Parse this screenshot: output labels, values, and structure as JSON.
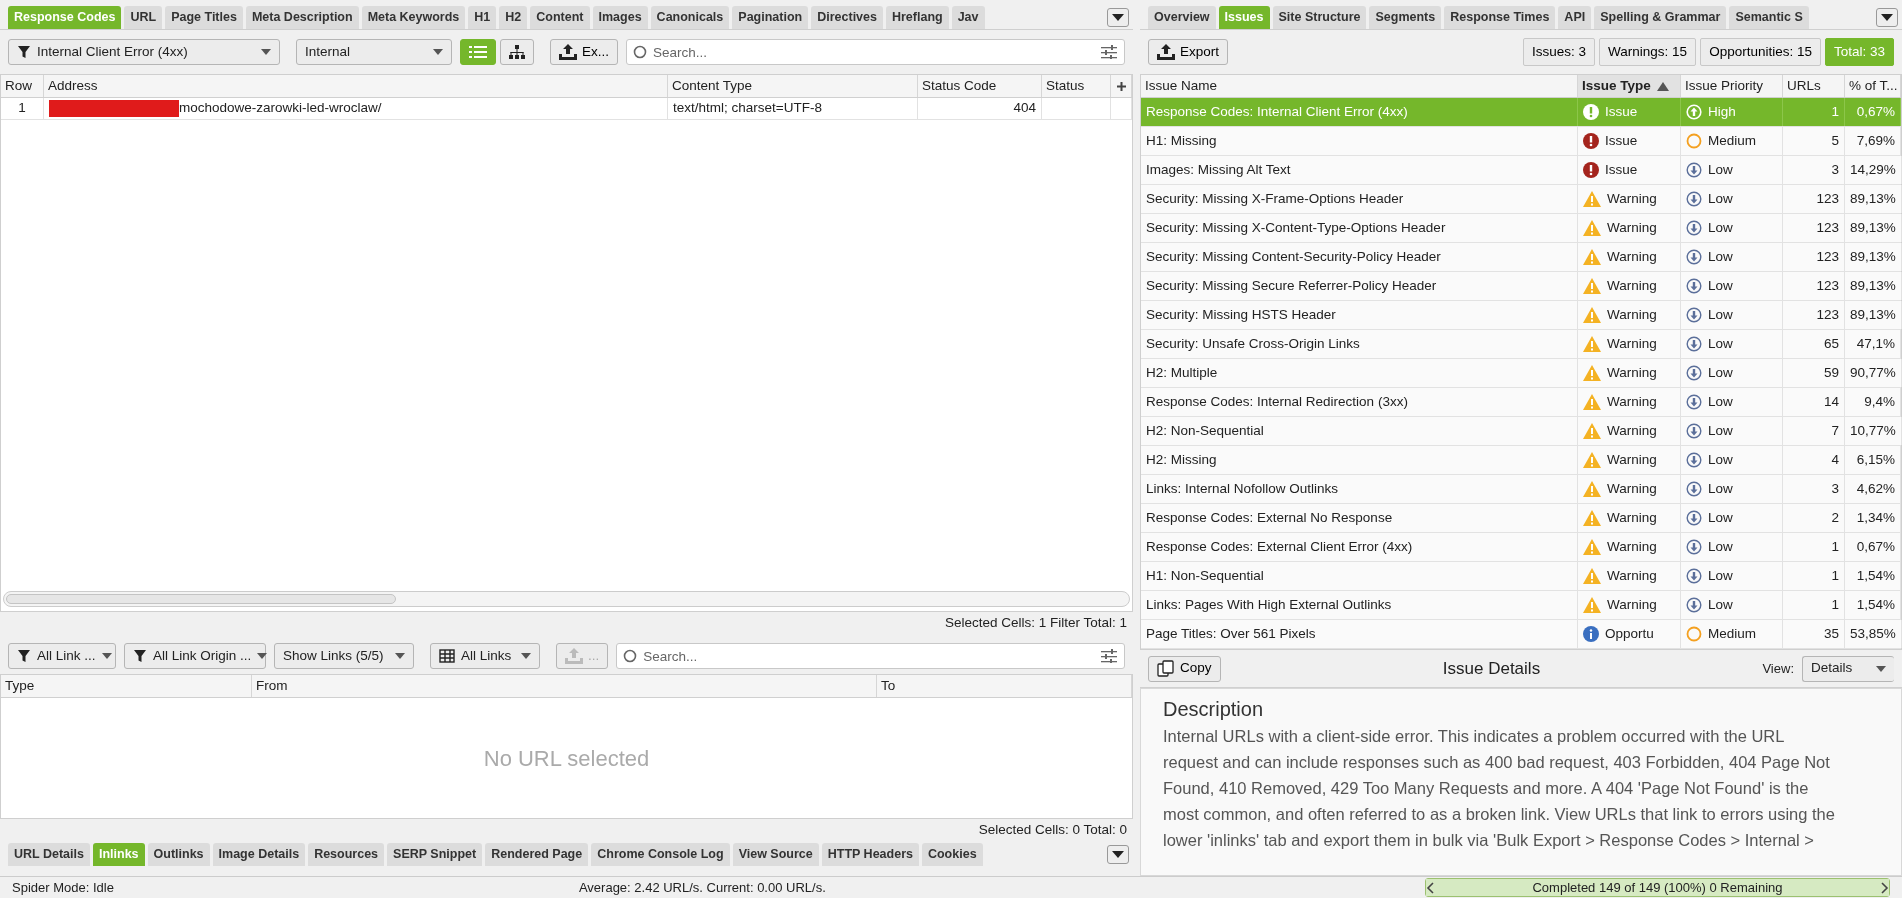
{
  "left_tabs": [
    {
      "label": "Response Codes",
      "selected": true
    },
    {
      "label": "URL",
      "selected": false
    },
    {
      "label": "Page Titles",
      "selected": false
    },
    {
      "label": "Meta Description",
      "selected": false
    },
    {
      "label": "Meta Keywords",
      "selected": false
    },
    {
      "label": "H1",
      "selected": false
    },
    {
      "label": "H2",
      "selected": false
    },
    {
      "label": "Content",
      "selected": false
    },
    {
      "label": "Images",
      "selected": false
    },
    {
      "label": "Canonicals",
      "selected": false
    },
    {
      "label": "Pagination",
      "selected": false
    },
    {
      "label": "Directives",
      "selected": false
    },
    {
      "label": "Hreflang",
      "selected": false
    },
    {
      "label": "Jav",
      "selected": false
    }
  ],
  "main_toolbar": {
    "status_filter": "Internal Client Error (4xx)",
    "scope": "Internal",
    "view_modes": [
      {
        "kind": "list",
        "selected": true
      },
      {
        "kind": "tree",
        "selected": false
      }
    ],
    "export_label": "Ex...",
    "search_placeholder": "Search..."
  },
  "main_table": {
    "columns": [
      "Row",
      "Address",
      "Content Type",
      "Status Code",
      "Status"
    ],
    "rows": [
      {
        "row": "1",
        "address": "mochodowe-zarowki-led-wroclaw/",
        "redacted": true,
        "content_type": "text/html; charset=UTF-8",
        "status_code": "404"
      }
    ],
    "footer": "Selected Cells:  1  Filter Total:  1"
  },
  "links_toolbar": {
    "dropdowns": [
      {
        "kind": "filter",
        "label": "All Link ..."
      },
      {
        "kind": "filter",
        "label": "All Link Origin ..."
      },
      {
        "kind": "plain",
        "label": "Show Links (5/5)"
      },
      {
        "kind": "table",
        "label": "All Links"
      }
    ],
    "export_label": "...",
    "export_disabled": true,
    "search_placeholder": "Search..."
  },
  "links_table": {
    "columns": [
      "Type",
      "From",
      "To"
    ],
    "empty_message": "No URL selected",
    "footer": "Selected Cells:  0  Total:  0"
  },
  "bottom_tabs": [
    {
      "label": "URL Details",
      "selected": false
    },
    {
      "label": "Inlinks",
      "selected": true
    },
    {
      "label": "Outlinks",
      "selected": false
    },
    {
      "label": "Image Details",
      "selected": false
    },
    {
      "label": "Resources",
      "selected": false
    },
    {
      "label": "SERP Snippet",
      "selected": false
    },
    {
      "label": "Rendered Page",
      "selected": false
    },
    {
      "label": "Chrome Console Log",
      "selected": false
    },
    {
      "label": "View Source",
      "selected": false
    },
    {
      "label": "HTTP Headers",
      "selected": false
    },
    {
      "label": "Cookies",
      "selected": false
    }
  ],
  "right_tabs": [
    {
      "label": "Overview",
      "selected": false
    },
    {
      "label": "Issues",
      "selected": true
    },
    {
      "label": "Site Structure",
      "selected": false
    },
    {
      "label": "Segments",
      "selected": false
    },
    {
      "label": "Response Times",
      "selected": false
    },
    {
      "label": "API",
      "selected": false
    },
    {
      "label": "Spelling & Grammar",
      "selected": false
    },
    {
      "label": "Semantic S",
      "selected": false
    }
  ],
  "issues_toolbar": {
    "export_label": "Export",
    "counts": [
      {
        "label": "Issues: 3",
        "selected": false
      },
      {
        "label": "Warnings: 15",
        "selected": false
      },
      {
        "label": "Opportunities: 15",
        "selected": false
      },
      {
        "label": "Total: 33",
        "selected": true
      }
    ]
  },
  "issues_table": {
    "columns": [
      {
        "label": "Issue Name",
        "sorted": false
      },
      {
        "label": "Issue Type",
        "sorted": true
      },
      {
        "label": "Issue Priority",
        "sorted": false
      },
      {
        "label": "URLs",
        "sorted": false
      },
      {
        "label": "% of T...",
        "sorted": false
      }
    ],
    "rows": [
      {
        "name": "Response Codes: Internal Client Error (4xx)",
        "type": {
          "kind": "issue",
          "label": "Issue"
        },
        "priority": {
          "kind": "high",
          "label": "High"
        },
        "urls": "1",
        "percent": "0,67%",
        "selected": true
      },
      {
        "name": "H1: Missing",
        "type": {
          "kind": "issue",
          "label": "Issue"
        },
        "priority": {
          "kind": "medium",
          "label": "Medium"
        },
        "urls": "5",
        "percent": "7,69%",
        "selected": false
      },
      {
        "name": "Images: Missing Alt Text",
        "type": {
          "kind": "issue",
          "label": "Issue"
        },
        "priority": {
          "kind": "low",
          "label": "Low"
        },
        "urls": "3",
        "percent": "14,29%",
        "selected": false
      },
      {
        "name": "Security: Missing X-Frame-Options Header",
        "type": {
          "kind": "warning",
          "label": "Warning"
        },
        "priority": {
          "kind": "low",
          "label": "Low"
        },
        "urls": "123",
        "percent": "89,13%",
        "selected": false
      },
      {
        "name": "Security: Missing X-Content-Type-Options Header",
        "type": {
          "kind": "warning",
          "label": "Warning"
        },
        "priority": {
          "kind": "low",
          "label": "Low"
        },
        "urls": "123",
        "percent": "89,13%",
        "selected": false
      },
      {
        "name": "Security: Missing Content-Security-Policy Header",
        "type": {
          "kind": "warning",
          "label": "Warning"
        },
        "priority": {
          "kind": "low",
          "label": "Low"
        },
        "urls": "123",
        "percent": "89,13%",
        "selected": false
      },
      {
        "name": "Security: Missing Secure Referrer-Policy Header",
        "type": {
          "kind": "warning",
          "label": "Warning"
        },
        "priority": {
          "kind": "low",
          "label": "Low"
        },
        "urls": "123",
        "percent": "89,13%",
        "selected": false
      },
      {
        "name": "Security: Missing HSTS Header",
        "type": {
          "kind": "warning",
          "label": "Warning"
        },
        "priority": {
          "kind": "low",
          "label": "Low"
        },
        "urls": "123",
        "percent": "89,13%",
        "selected": false
      },
      {
        "name": "Security: Unsafe Cross-Origin Links",
        "type": {
          "kind": "warning",
          "label": "Warning"
        },
        "priority": {
          "kind": "low",
          "label": "Low"
        },
        "urls": "65",
        "percent": "47,1%",
        "selected": false
      },
      {
        "name": "H2: Multiple",
        "type": {
          "kind": "warning",
          "label": "Warning"
        },
        "priority": {
          "kind": "low",
          "label": "Low"
        },
        "urls": "59",
        "percent": "90,77%",
        "selected": false
      },
      {
        "name": "Response Codes: Internal Redirection (3xx)",
        "type": {
          "kind": "warning",
          "label": "Warning"
        },
        "priority": {
          "kind": "low",
          "label": "Low"
        },
        "urls": "14",
        "percent": "9,4%",
        "selected": false
      },
      {
        "name": "H2: Non-Sequential",
        "type": {
          "kind": "warning",
          "label": "Warning"
        },
        "priority": {
          "kind": "low",
          "label": "Low"
        },
        "urls": "7",
        "percent": "10,77%",
        "selected": false
      },
      {
        "name": "H2: Missing",
        "type": {
          "kind": "warning",
          "label": "Warning"
        },
        "priority": {
          "kind": "low",
          "label": "Low"
        },
        "urls": "4",
        "percent": "6,15%",
        "selected": false
      },
      {
        "name": "Links: Internal Nofollow Outlinks",
        "type": {
          "kind": "warning",
          "label": "Warning"
        },
        "priority": {
          "kind": "low",
          "label": "Low"
        },
        "urls": "3",
        "percent": "4,62%",
        "selected": false
      },
      {
        "name": "Response Codes: External No Response",
        "type": {
          "kind": "warning",
          "label": "Warning"
        },
        "priority": {
          "kind": "low",
          "label": "Low"
        },
        "urls": "2",
        "percent": "1,34%",
        "selected": false
      },
      {
        "name": "Response Codes: External Client Error (4xx)",
        "type": {
          "kind": "warning",
          "label": "Warning"
        },
        "priority": {
          "kind": "low",
          "label": "Low"
        },
        "urls": "1",
        "percent": "0,67%",
        "selected": false
      },
      {
        "name": "H1: Non-Sequential",
        "type": {
          "kind": "warning",
          "label": "Warning"
        },
        "priority": {
          "kind": "low",
          "label": "Low"
        },
        "urls": "1",
        "percent": "1,54%",
        "selected": false
      },
      {
        "name": "Links: Pages With High External Outlinks",
        "type": {
          "kind": "warning",
          "label": "Warning"
        },
        "priority": {
          "kind": "low",
          "label": "Low"
        },
        "urls": "1",
        "percent": "1,54%",
        "selected": false
      },
      {
        "name": "Page Titles: Over 561 Pixels",
        "type": {
          "kind": "opportunity",
          "label": "Opportu"
        },
        "priority": {
          "kind": "medium",
          "label": "Medium"
        },
        "urls": "35",
        "percent": "53,85%",
        "selected": false
      }
    ]
  },
  "issue_details": {
    "copy_label": "Copy",
    "title": "Issue Details",
    "view_label": "View:",
    "view_value": "Details",
    "heading": "Description",
    "text": "Internal URLs with a client-side error. This indicates a problem occurred with the URL request and can include responses such as 400 bad request, 403 Forbidden, 404 Page Not Found, 410 Removed, 429 Too Many Requests and more. A 404 'Page Not Found' is the most common, and often referred to as a broken link. View URLs that link to errors using the lower 'inlinks' tab and export them in bulk via 'Bulk Export > Response Codes > Internal >"
  },
  "status_bar": {
    "spider_mode": "Spider Mode: Idle",
    "speed": "Average: 2.42 URL/s. Current: 0.00 URL/s.",
    "progress_text": "Completed 149 of 149 (100%) 0 Remaining",
    "level": 1
  }
}
